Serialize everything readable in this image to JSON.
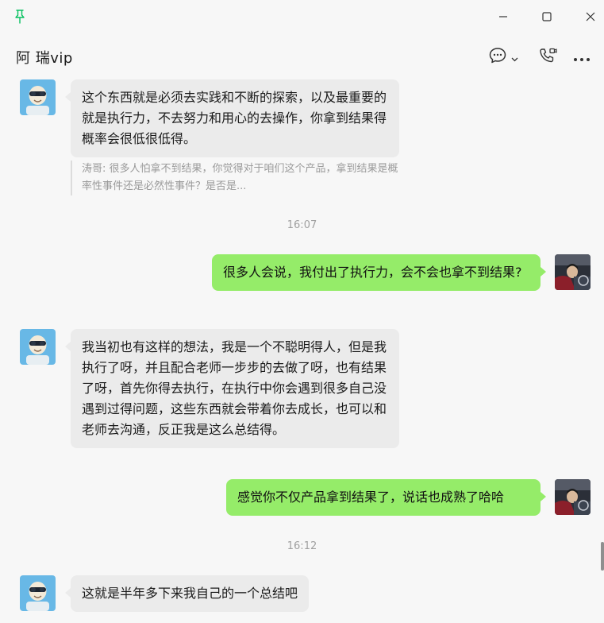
{
  "window": {
    "pin_icon": "pin-icon",
    "controls": [
      "minimize-icon",
      "maximize-icon",
      "close-icon"
    ]
  },
  "header": {
    "title": "阿 瑞vip",
    "icons": [
      "chat-bubble-icon",
      "chevron-down-icon",
      "video-call-icon",
      "more-icon"
    ]
  },
  "messages": [
    {
      "side": "in",
      "text": "这个东西就是必须去实践和不断的探索，以及最重要的就是执行力，不去努力和用心的去操作，你拿到结果得概率会很低很低得。",
      "quote": "涛哥: 很多人怕拿不到结果，你觉得对于咱们这个产品，拿到结果是概率性事件还是必然性事件？是否是..."
    },
    {
      "time": "16:07"
    },
    {
      "side": "out",
      "text": "很多人会说，我付出了执行力，会不会也拿不到结果?"
    },
    {
      "side": "in",
      "text": "我当初也有这样的想法，我是一个不聪明得人，但是我执行了呀，并且配合老师一步步的去做了呀，也有结果了呀，首先你得去执行，在执行中你会遇到很多自己没遇到过得问题，这些东西就会带着你去成长，也可以和老师去沟通，反正我是这么总结得。"
    },
    {
      "side": "out",
      "text": "感觉你不仅产品拿到结果了，说话也成熟了哈哈"
    },
    {
      "time": "16:12"
    },
    {
      "side": "in",
      "text": "这就是半年多下来我自己的一个总结吧"
    }
  ],
  "colors": {
    "incoming_bubble": "#ebebeb",
    "outgoing_bubble": "#95ec69",
    "background": "#f7f7f7",
    "pin": "#07c160"
  }
}
